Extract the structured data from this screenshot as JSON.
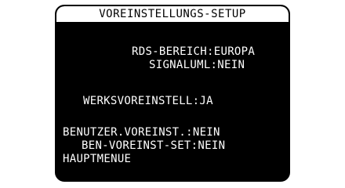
{
  "screen": {
    "title": "VOREINSTELLUNGS-SETUP",
    "lines": [
      "RDS-BEREICH:EUROPA",
      "SIGNALUML:NEIN",
      "WERKSVOREINSTELL:JA",
      "BENUTZER.VOREINST.:NEIN",
      "BEN-VOREINST-SET:NEIN",
      "HAUPTMENUE"
    ]
  },
  "colors": {
    "screen_background": "#000000",
    "text": "#ffffff",
    "title_bar": "#ffffff",
    "title_text": "#000000"
  }
}
